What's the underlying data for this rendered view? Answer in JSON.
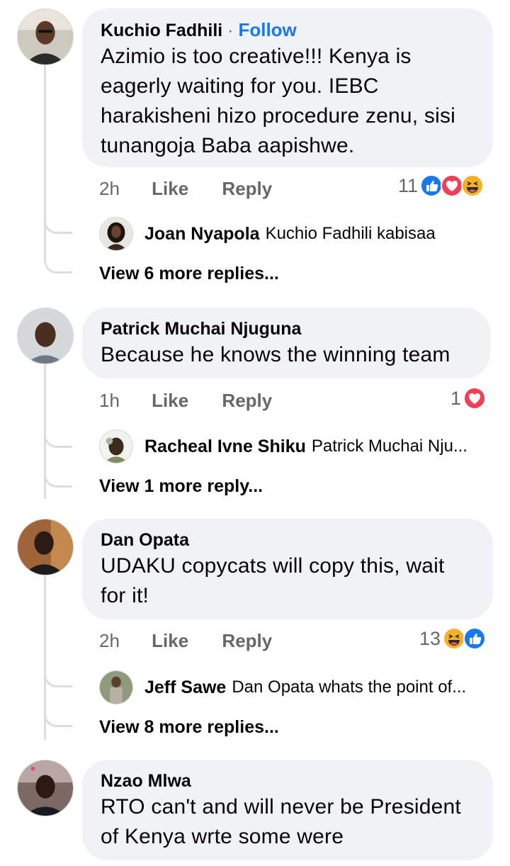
{
  "comments": [
    {
      "author": "Kuchio Fadhili",
      "follow_sep": "·",
      "follow_label": "Follow",
      "text_lines": [
        "Azimio is too creative!!! Kenya is",
        "eagerly waiting for you. IEBC",
        "harakisheni hizo procedure zenu, sisi",
        "tunangoja Baba aapishwe."
      ],
      "time": "2h",
      "like_label": "Like",
      "reply_label": "Reply",
      "reaction_count": "11",
      "reactions": [
        "like",
        "love",
        "haha"
      ],
      "reply_preview": {
        "author": "Joan Nyapola",
        "text": "Kuchio Fadhili kabisaa"
      },
      "more_replies": "View 6 more replies..."
    },
    {
      "author": "Patrick Muchai Njuguna",
      "text_lines": [
        "Because he knows the winning team"
      ],
      "time": "1h",
      "like_label": "Like",
      "reply_label": "Reply",
      "reaction_count": "1",
      "reactions": [
        "love"
      ],
      "reply_preview": {
        "author": "Racheal Ivne Shiku",
        "text": "Patrick Muchai Nju..."
      },
      "more_replies": "View 1 more reply..."
    },
    {
      "author": "Dan Opata",
      "text_lines": [
        "UDAKU copycats will copy this, wait",
        "for it!"
      ],
      "time": "2h",
      "like_label": "Like",
      "reply_label": "Reply",
      "reaction_count": "13",
      "reactions": [
        "haha",
        "like"
      ],
      "reply_preview": {
        "author": "Jeff Sawe",
        "text": "Dan Opata whats the point of..."
      },
      "more_replies": "View 8 more replies..."
    },
    {
      "author": "Nzao Mlwa",
      "text_lines": [
        "RTO can't and will never be President",
        "of Kenya wrte some were"
      ]
    }
  ],
  "colors": {
    "bubble": "#f0f2f5",
    "link": "#1877f2",
    "muted": "#65676b",
    "love": "#f33e58",
    "like": "#1877f2",
    "haha": "#f7b125"
  },
  "icons": {
    "like": "like-reaction-icon",
    "love": "love-reaction-icon",
    "haha": "haha-reaction-icon"
  }
}
